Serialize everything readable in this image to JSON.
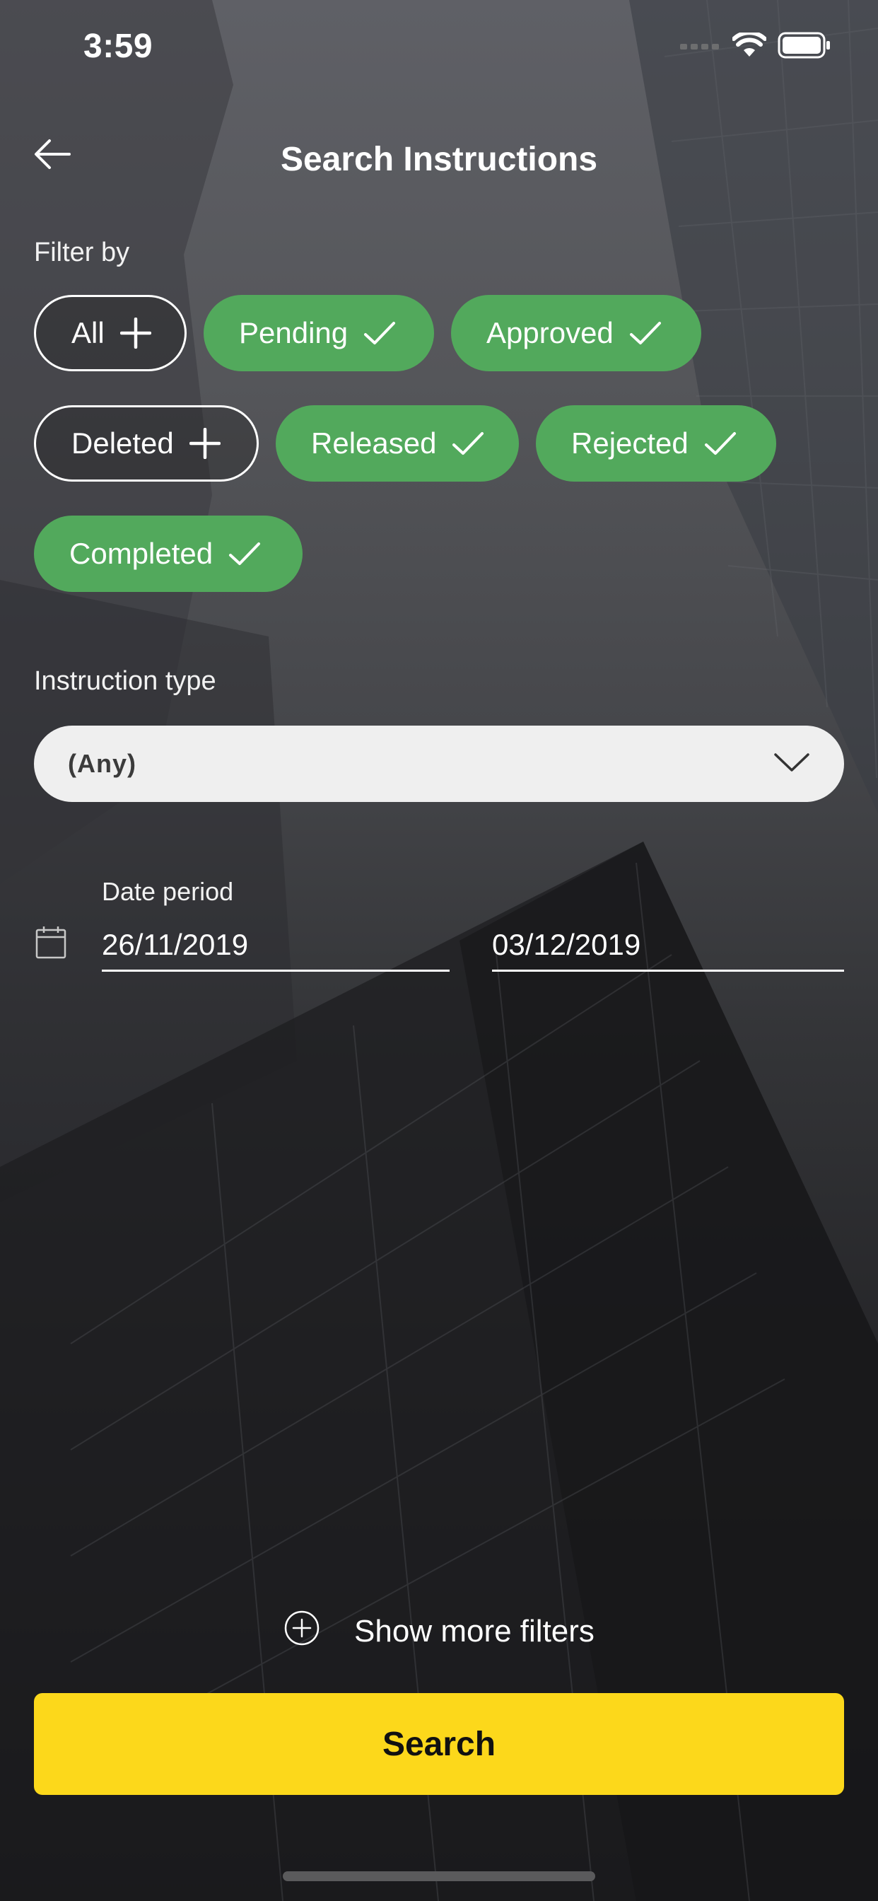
{
  "status_bar": {
    "time": "3:59",
    "wifi_icon": "wifi-icon",
    "battery_icon": "battery-icon"
  },
  "header": {
    "title": "Search Instructions",
    "back_icon": "arrow-left-icon"
  },
  "filter": {
    "label": "Filter by",
    "chips": [
      {
        "label": "All",
        "selected": false
      },
      {
        "label": "Pending",
        "selected": true
      },
      {
        "label": "Approved",
        "selected": true
      },
      {
        "label": "Deleted",
        "selected": false
      },
      {
        "label": "Released",
        "selected": true
      },
      {
        "label": "Rejected",
        "selected": true
      },
      {
        "label": "Completed",
        "selected": true
      }
    ]
  },
  "instruction_type": {
    "label": "Instruction type",
    "value": "(Any)"
  },
  "date_period": {
    "label": "Date period",
    "from": "26/11/2019",
    "to": "03/12/2019"
  },
  "more_filters": {
    "label": "Show more filters"
  },
  "search_button": {
    "label": "Search"
  },
  "colors": {
    "chip_selected": "#52a95c",
    "primary_button": "#fcd81b",
    "dropdown_bg": "#efefef"
  }
}
